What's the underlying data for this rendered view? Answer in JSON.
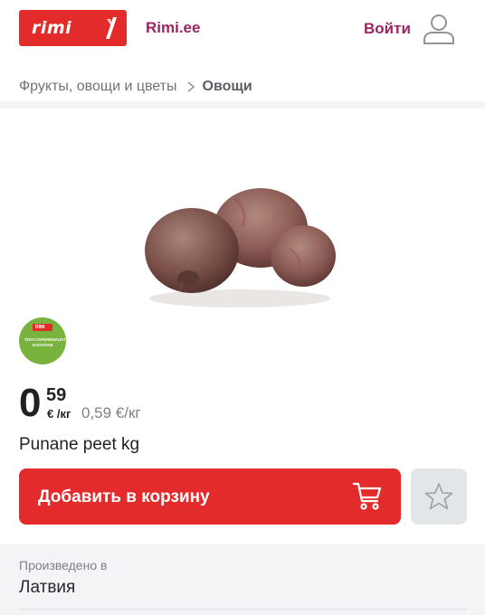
{
  "header": {
    "logo_text": "rimi",
    "site_link": "Rimi.ee",
    "login_label": "Войти"
  },
  "breadcrumb": {
    "parent": "Фрукты, овощи и цветы",
    "current": "Овощи"
  },
  "badge": {
    "logo_text": "RIMI",
    "line1": "TOOTJAPERENÄUSTAJA",
    "line2": "SOOVITAB"
  },
  "product": {
    "image_subject": "beetroot",
    "price_integer": "0",
    "price_decimal": "59",
    "price_unit": "€ /кг",
    "price_per_unit": "0,59 €/кг",
    "name": "Punane peet kg"
  },
  "actions": {
    "add_to_cart_label": "Добавить в корзину"
  },
  "details": {
    "origin_label": "Произведено в",
    "origin_value": "Латвия"
  },
  "colors": {
    "brand_red": "#e32b2b",
    "accent_purple": "#9c2463",
    "badge_green": "#78b33d"
  },
  "icons": [
    "rimi-logo-icon",
    "user-icon",
    "chevron-right-icon",
    "cart-icon",
    "star-icon"
  ]
}
